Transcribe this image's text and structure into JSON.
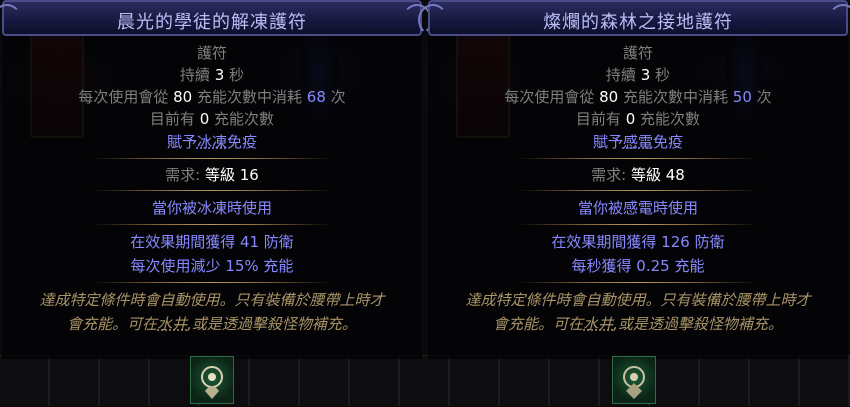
{
  "panels": [
    {
      "title": "晨光的學徒的解凍護符",
      "type": "護符",
      "duration_label": "持續",
      "duration_value": "3",
      "duration_unit": "秒",
      "charges_prefix": "每次使用會從",
      "charges_max": "80",
      "charges_mid": "充能次數中消耗",
      "charges_use": "68",
      "charges_suffix": "次",
      "current_prefix": "目前有",
      "current_value": "0",
      "current_suffix": "充能次數",
      "grant": "賦予冰凍免疫",
      "grant_underlined": "冰凍",
      "req_label": "需求:",
      "req_text": "等級",
      "req_value": "16",
      "trigger": "當你被冰凍時使用",
      "mod1": "在效果期間獲得 41 防衛",
      "mod2": "每次使用減少 15% 充能",
      "flavor_line1": "達成特定條件時會自動使用。只有裝備於腰帶上時才",
      "flavor_line2_a": "會充能。可在",
      "flavor_line2_u": "水井",
      "flavor_line2_b": ",或是透過擊殺怪物補充。"
    },
    {
      "title": "燦爛的森林之接地護符",
      "type": "護符",
      "duration_label": "持續",
      "duration_value": "3",
      "duration_unit": "秒",
      "charges_prefix": "每次使用會從",
      "charges_max": "80",
      "charges_mid": "充能次數中消耗",
      "charges_use": "50",
      "charges_suffix": "次",
      "current_prefix": "目前有",
      "current_value": "0",
      "current_suffix": "充能次數",
      "grant": "賦予感電免疫",
      "grant_underlined": "感電",
      "req_label": "需求:",
      "req_text": "等級",
      "req_value": "48",
      "trigger": "當你被感電時使用",
      "mod1": "在效果期間獲得 126 防衛",
      "mod2": "每秒獲得 0.25 充能",
      "flavor_line1": "達成特定條件時會自動使用。只有裝備於腰帶上時才",
      "flavor_line2_a": "會充能。可在",
      "flavor_line2_u": "水井",
      "flavor_line2_b": ",或是透過擊殺怪物補充。"
    }
  ],
  "colors": {
    "title": "#b9bdf4",
    "magic_blue": "#8888ff",
    "label_grey": "#7f7f7f",
    "flavor_gold": "#a89466"
  },
  "icons": [
    "charm-icon",
    "charm-icon"
  ]
}
